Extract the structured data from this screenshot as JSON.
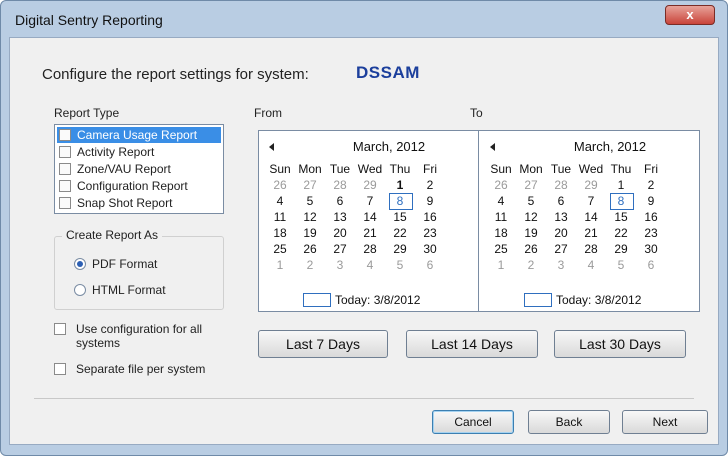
{
  "window": {
    "title": "Digital Sentry Reporting",
    "close_label": "x"
  },
  "header": {
    "text": "Configure the report settings for system:",
    "system": "DSSAM"
  },
  "report_type": {
    "label": "Report Type",
    "items": [
      {
        "label": "Camera Usage Report",
        "selected": true
      },
      {
        "label": "Activity Report"
      },
      {
        "label": "Zone/VAU Report"
      },
      {
        "label": "Configuration Report"
      },
      {
        "label": "Snap Shot Report"
      }
    ]
  },
  "create_as": {
    "label": "Create Report As",
    "options": [
      {
        "label": "PDF Format",
        "checked": true
      },
      {
        "label": "HTML Format",
        "checked": false
      }
    ]
  },
  "options": {
    "use_config_label": "Use configuration for all systems",
    "separate_label": "Separate file per system"
  },
  "from_label": "From",
  "to_label": "To",
  "calendar": {
    "month": "March, 2012",
    "days": [
      "Sun",
      "Mon",
      "Tue",
      "Wed",
      "Thu",
      "Fri"
    ],
    "rows": [
      [
        "26",
        "27",
        "28",
        "29",
        "1",
        "2"
      ],
      [
        "4",
        "5",
        "6",
        "7",
        "8",
        "9"
      ],
      [
        "11",
        "12",
        "13",
        "14",
        "15",
        "16"
      ],
      [
        "18",
        "19",
        "20",
        "21",
        "22",
        "23"
      ],
      [
        "25",
        "26",
        "27",
        "28",
        "29",
        "30"
      ],
      [
        "1",
        "2",
        "3",
        "4",
        "5",
        "6"
      ]
    ],
    "today": "Today: 3/8/2012"
  },
  "quick_ranges": [
    "Last 7 Days",
    "Last 14 Days",
    "Last 30 Days"
  ],
  "footer": {
    "cancel": "Cancel",
    "back": "Back",
    "next": "Next"
  }
}
